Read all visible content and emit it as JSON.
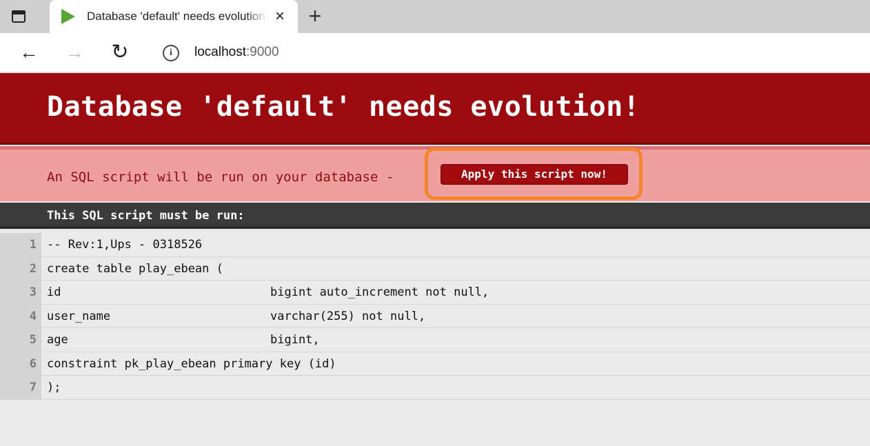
{
  "browser": {
    "tab_title": "Database 'default' needs evolution!",
    "tab_close": "×",
    "new_tab": "+",
    "back": "←",
    "forward": "→",
    "reload": "↻",
    "info": "i",
    "url_host": "localhost",
    "url_port": ":9000"
  },
  "page": {
    "title": "Database 'default' needs evolution!",
    "subheader_text": "An SQL script will be run on your database -",
    "apply_button": "Apply this script now!",
    "sql_label": "This SQL script must be run:",
    "sql_lines": [
      {
        "no": "1",
        "a": "-- Rev:1,Ups - 0318526",
        "b": ""
      },
      {
        "no": "2",
        "a": "create table play_ebean (",
        "b": ""
      },
      {
        "no": "3",
        "a": "id",
        "b": "bigint auto_increment not null,"
      },
      {
        "no": "4",
        "a": "user_name",
        "b": "varchar(255) not null,"
      },
      {
        "no": "5",
        "a": "age",
        "b": "bigint,"
      },
      {
        "no": "6",
        "a": "constraint pk_play_ebean primary key (id)",
        "b": ""
      },
      {
        "no": "7",
        "a": ");",
        "b": ""
      }
    ]
  },
  "colors": {
    "header_bg": "#9b0a0f",
    "subheader_bg": "#ef9f9f",
    "highlight": "#f5852a",
    "favicon": "#5aa535"
  }
}
